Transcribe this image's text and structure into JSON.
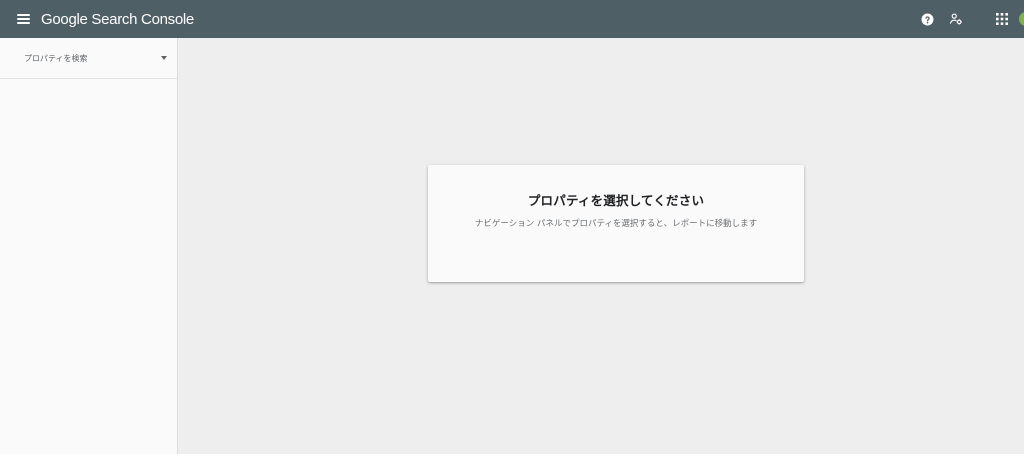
{
  "header": {
    "product_name": "Google Search Console",
    "icons": {
      "menu": "menu-icon",
      "help": "help-icon",
      "users": "manage-users-icon",
      "apps": "apps-grid-icon",
      "avatar": "account-avatar"
    },
    "bar_color": "#4f5f66"
  },
  "sidebar": {
    "property_search_placeholder": "プロパティを検索"
  },
  "main": {
    "card": {
      "title": "プロパティを選択してください",
      "body": "ナビゲーション パネルでプロパティを選択すると、レポートに移動します"
    }
  }
}
